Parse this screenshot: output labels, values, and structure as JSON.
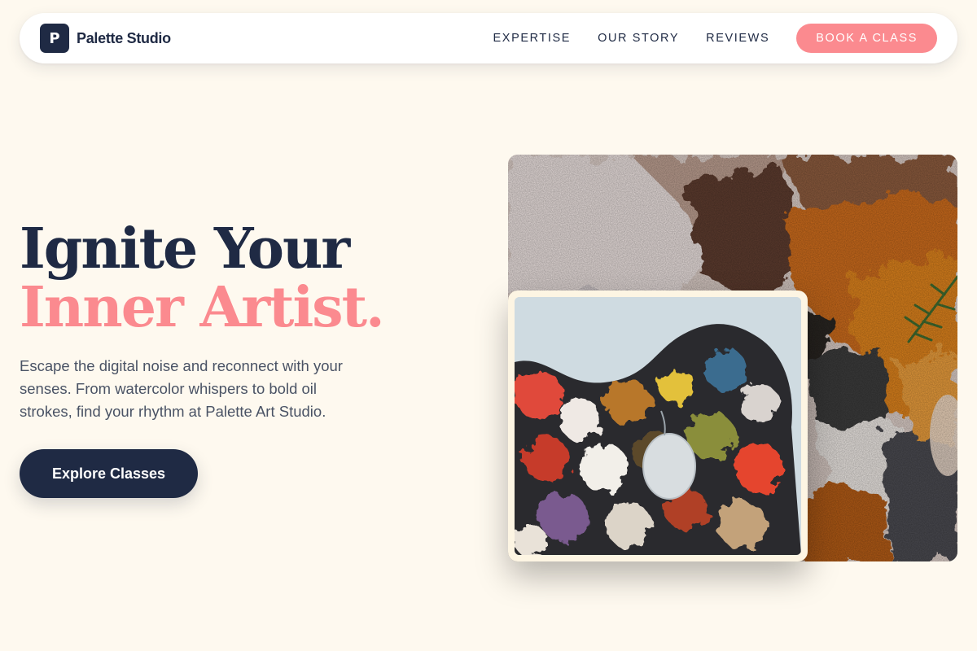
{
  "nav": {
    "brand_initial": "P",
    "brand_name": "Palette Studio",
    "links": [
      "EXPERTISE",
      "OUR STORY",
      "REVIEWS"
    ],
    "cta_label": "BOOK A CLASS"
  },
  "hero": {
    "title_line1": "Ignite Your",
    "title_line2": "Inner Artist.",
    "description": "Escape the digital noise and reconnect with your senses. From watercolor whispers to bold oil strokes, find your rhythm at Palette Art Studio.",
    "cta_label": "Explore Classes"
  },
  "colors": {
    "navy": "#1f2a44",
    "coral": "#fb8a8f",
    "background": "#fef9ef"
  },
  "images": {
    "back": "textured-oil-paint-closeup",
    "front": "artist-palette-with-paint"
  }
}
